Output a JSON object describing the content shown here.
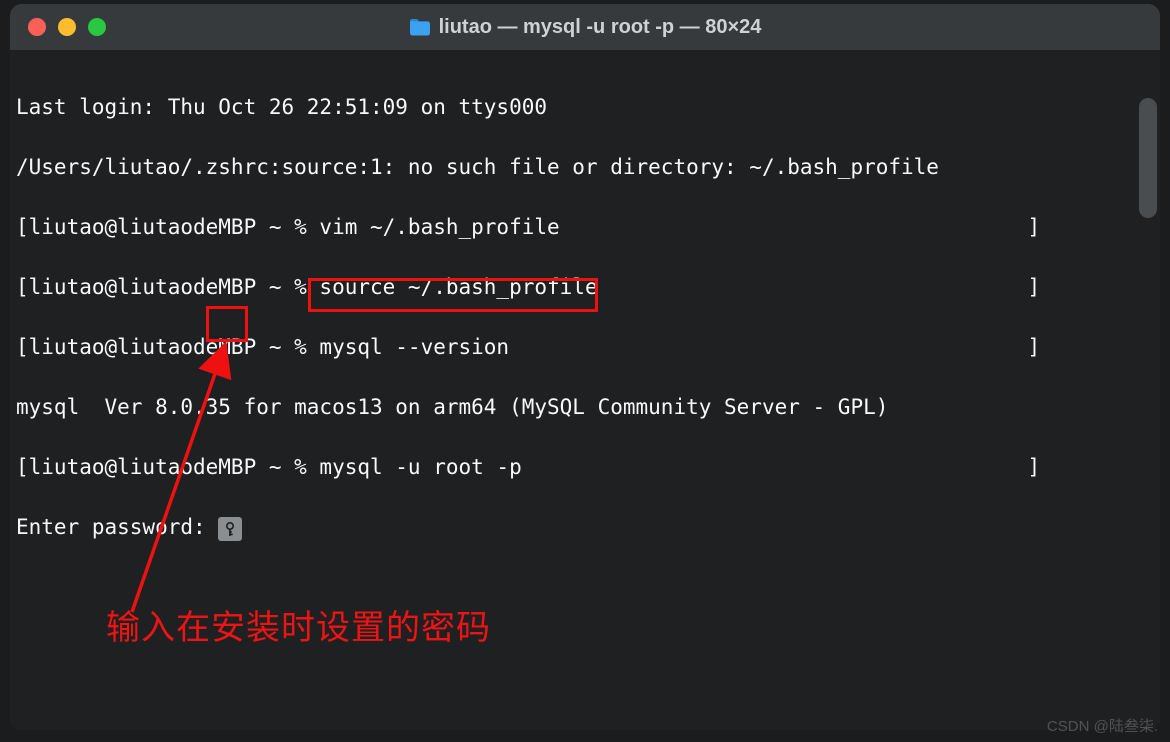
{
  "titlebar": {
    "title": "liutao — mysql -u root -p — 80×24"
  },
  "terminal": {
    "lines": [
      "Last login: Thu Oct 26 22:51:09 on ttys000",
      "/Users/liutao/.zshrc:source:1: no such file or directory: ~/.bash_profile",
      "[liutao@liutaodeMBP ~ % vim ~/.bash_profile                                     ]",
      "[liutao@liutaodeMBP ~ % source ~/.bash_profile                                  ]",
      "[liutao@liutaodeMBP ~ % mysql --version                                         ]",
      "mysql  Ver 8.0.35 for macos13 on arm64 (MySQL Community Server - GPL)",
      "[liutao@liutaodeMBP ~ % mysql -u root -p                                        ]",
      "Enter password: "
    ]
  },
  "annotation": {
    "text": "输入在安装时设置的密码"
  },
  "watermark": "CSDN @陆叁柒."
}
